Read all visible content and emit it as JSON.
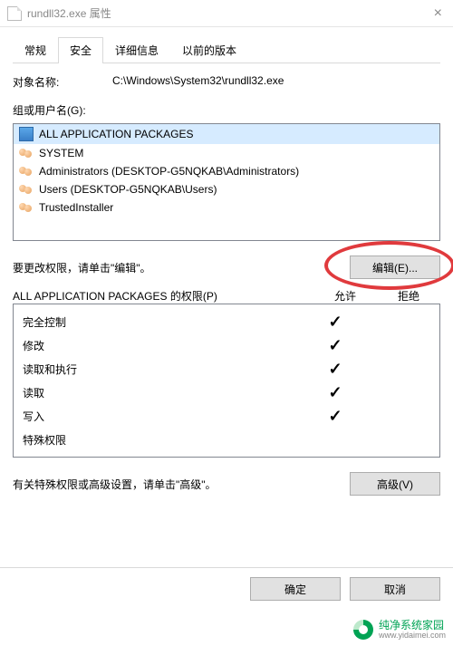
{
  "titlebar": {
    "title": "rundll32.exe 属性"
  },
  "tabs": [
    {
      "label": "常规"
    },
    {
      "label": "安全"
    },
    {
      "label": "详细信息"
    },
    {
      "label": "以前的版本"
    }
  ],
  "object": {
    "label": "对象名称:",
    "value": "C:\\Windows\\System32\\rundll32.exe"
  },
  "groups": {
    "label": "组或用户名(G):",
    "items": [
      {
        "name": "ALL APPLICATION PACKAGES",
        "icon": "pkg",
        "selected": true
      },
      {
        "name": "SYSTEM",
        "icon": "users"
      },
      {
        "name": "Administrators (DESKTOP-G5NQKAB\\Administrators)",
        "icon": "users"
      },
      {
        "name": "Users (DESKTOP-G5NQKAB\\Users)",
        "icon": "users"
      },
      {
        "name": "TrustedInstaller",
        "icon": "users"
      }
    ]
  },
  "edit": {
    "instruction": "要更改权限，请单击\"编辑\"。",
    "button": "编辑(E)..."
  },
  "permissions": {
    "for_label": "ALL APPLICATION PACKAGES 的权限(P)",
    "allow": "允许",
    "deny": "拒绝",
    "rows": [
      {
        "name": "完全控制",
        "allow": false,
        "deny": false
      },
      {
        "name": "修改",
        "allow": false,
        "deny": false
      },
      {
        "name": "读取和执行",
        "allow": true,
        "deny": false
      },
      {
        "name": "读取",
        "allow": true,
        "deny": false
      },
      {
        "name": "写入",
        "allow": false,
        "deny": false
      },
      {
        "name": "特殊权限",
        "allow": false,
        "deny": false
      }
    ]
  },
  "advanced": {
    "instruction": "有关特殊权限或高级设置，请单击\"高级\"。",
    "button": "高级(V)"
  },
  "footer": {
    "ok": "确定",
    "cancel": "取消"
  },
  "watermark": {
    "brand": "纯净系统家园",
    "url": "www.yidaimei.com"
  }
}
